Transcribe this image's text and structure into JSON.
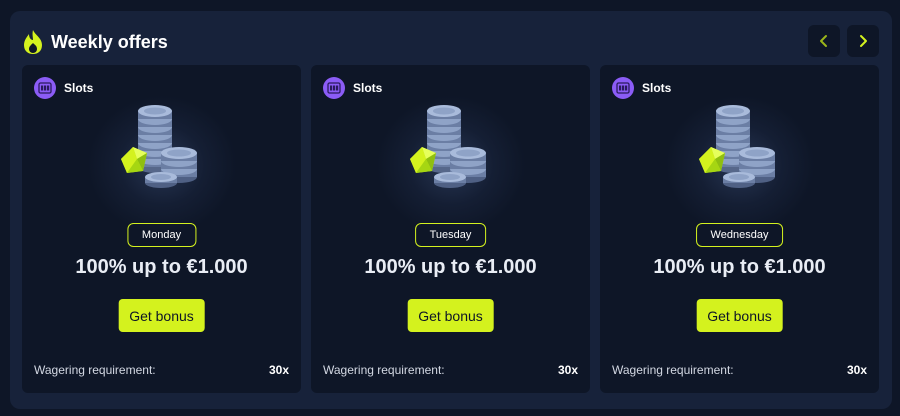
{
  "header": {
    "title": "Weekly offers",
    "icon": "flame-icon",
    "accent_color": "#d4f21e"
  },
  "nav": {
    "prev_icon": "chevron-left-icon",
    "next_icon": "chevron-right-icon"
  },
  "cards": [
    {
      "category": "Slots",
      "category_icon": "slot-machine-icon",
      "day": "Monday",
      "offer": "100% up to €1.000",
      "button": "Get bonus",
      "wager_label": "Wagering requirement:",
      "wager_value": "30x"
    },
    {
      "category": "Slots",
      "category_icon": "slot-machine-icon",
      "day": "Tuesday",
      "offer": "100% up to €1.000",
      "button": "Get bonus",
      "wager_label": "Wagering requirement:",
      "wager_value": "30x"
    },
    {
      "category": "Slots",
      "category_icon": "slot-machine-icon",
      "day": "Wednesday",
      "offer": "100% up to €1.000",
      "button": "Get bonus",
      "wager_label": "Wagering requirement:",
      "wager_value": "30x"
    }
  ]
}
